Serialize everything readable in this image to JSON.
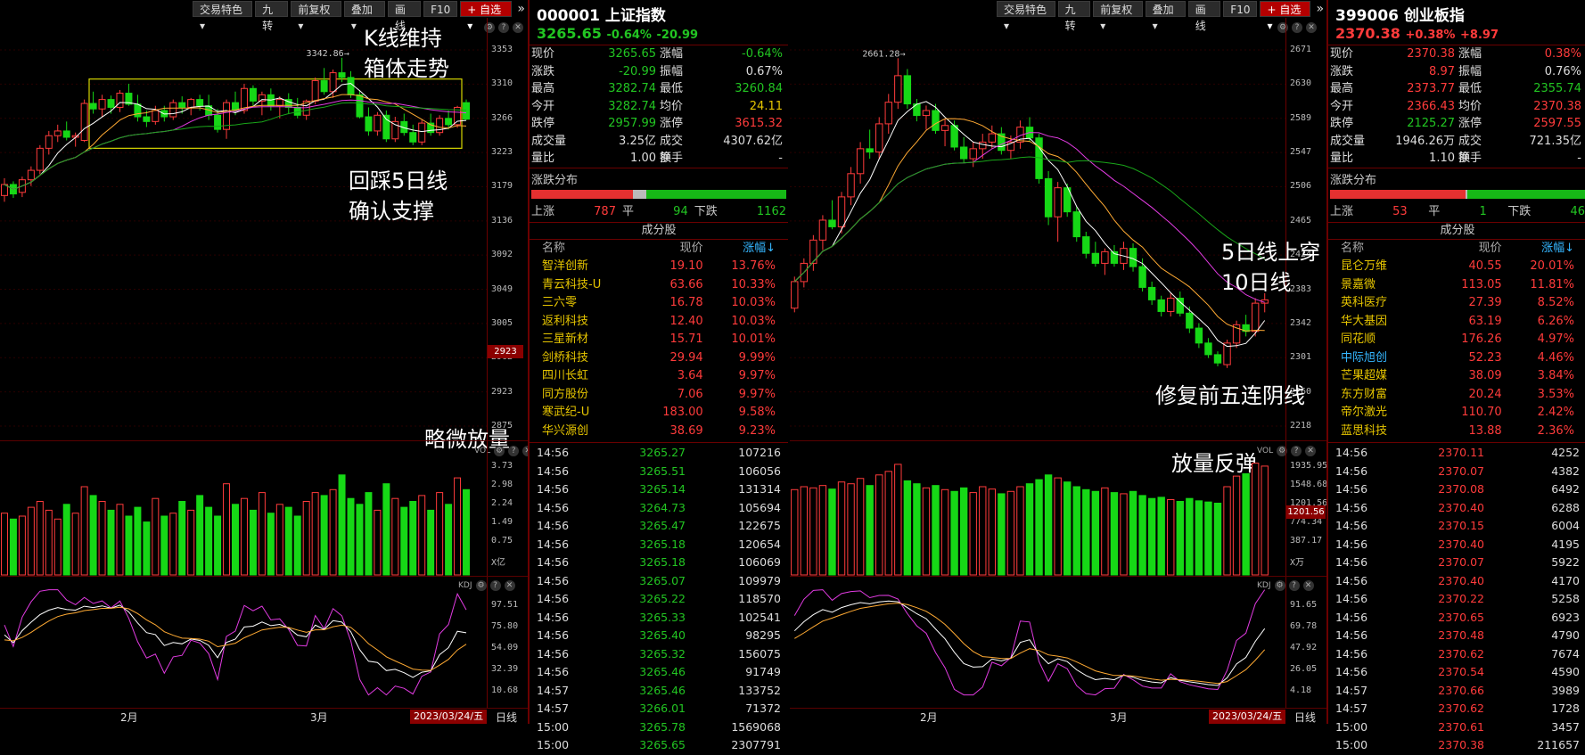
{
  "toolbar": {
    "items": [
      "交易特色",
      "九转",
      "前复权",
      "叠加",
      "画线",
      "F10",
      "自选"
    ],
    "more": "»"
  },
  "left": {
    "index_code": "000001",
    "index_name": "上证指数",
    "price": "3265.65",
    "change_pct": "-0.64%",
    "change": "-20.99",
    "price_axis": [
      "3353",
      "3310",
      "3266",
      "3223",
      "3179",
      "3136",
      "3092",
      "3049",
      "3005",
      "2962",
      "2923",
      "2875"
    ],
    "current_box": "2923",
    "high_marker": "3342.86",
    "vol_axis": [
      "3.73",
      "2.98",
      "2.24",
      "1.49",
      "0.75",
      "X亿"
    ],
    "vol_label": "VOL",
    "kdj_label": "KDJ",
    "kdj_axis": [
      "97.51",
      "75.80",
      "54.09",
      "32.39",
      "10.68"
    ],
    "months": [
      "2月",
      "3月"
    ],
    "date": "2023/03/24/五",
    "period": "日线",
    "annotations": [
      "K线维持",
      "箱体走势",
      "回踩5日线",
      "确认支撑",
      "略微放量"
    ],
    "candles": [
      [
        3168,
        3190,
        3160,
        3182
      ],
      [
        3182,
        3186,
        3165,
        3170
      ],
      [
        3172,
        3192,
        3166,
        3188
      ],
      [
        3188,
        3205,
        3180,
        3200
      ],
      [
        3200,
        3232,
        3195,
        3228
      ],
      [
        3228,
        3250,
        3220,
        3244
      ],
      [
        3244,
        3258,
        3236,
        3250
      ],
      [
        3250,
        3262,
        3238,
        3242
      ],
      [
        3242,
        3248,
        3230,
        3244
      ],
      [
        3238,
        3290,
        3236,
        3285
      ],
      [
        3285,
        3300,
        3272,
        3278
      ],
      [
        3278,
        3296,
        3268,
        3290
      ],
      [
        3290,
        3295,
        3272,
        3280
      ],
      [
        3280,
        3302,
        3274,
        3298
      ],
      [
        3298,
        3310,
        3282,
        3284
      ],
      [
        3284,
        3296,
        3262,
        3268
      ],
      [
        3268,
        3276,
        3255,
        3262
      ],
      [
        3262,
        3282,
        3258,
        3276
      ],
      [
        3276,
        3282,
        3262,
        3268
      ],
      [
        3268,
        3290,
        3264,
        3286
      ],
      [
        3286,
        3294,
        3272,
        3280
      ],
      [
        3280,
        3292,
        3270,
        3290
      ],
      [
        3290,
        3296,
        3276,
        3282
      ],
      [
        3282,
        3296,
        3264,
        3270
      ],
      [
        3270,
        3278,
        3248,
        3252
      ],
      [
        3252,
        3290,
        3240,
        3286
      ],
      [
        3286,
        3300,
        3270,
        3276
      ],
      [
        3276,
        3310,
        3272,
        3304
      ],
      [
        3304,
        3308,
        3282,
        3288
      ],
      [
        3288,
        3300,
        3270,
        3296
      ],
      [
        3296,
        3304,
        3276,
        3282
      ],
      [
        3282,
        3294,
        3266,
        3290
      ],
      [
        3290,
        3298,
        3272,
        3280
      ],
      [
        3280,
        3292,
        3266,
        3270
      ],
      [
        3270,
        3290,
        3264,
        3288
      ],
      [
        3288,
        3318,
        3284,
        3314
      ],
      [
        3314,
        3330,
        3296,
        3300
      ],
      [
        3300,
        3328,
        3292,
        3324
      ],
      [
        3324,
        3343,
        3312,
        3318
      ],
      [
        3318,
        3326,
        3292,
        3296
      ],
      [
        3296,
        3302,
        3266,
        3268
      ],
      [
        3268,
        3280,
        3244,
        3250
      ],
      [
        3250,
        3274,
        3244,
        3270
      ],
      [
        3270,
        3276,
        3236,
        3240
      ],
      [
        3240,
        3268,
        3236,
        3262
      ],
      [
        3262,
        3272,
        3244,
        3248
      ],
      [
        3248,
        3258,
        3232,
        3236
      ],
      [
        3236,
        3264,
        3232,
        3260
      ],
      [
        3260,
        3272,
        3244,
        3248
      ],
      [
        3248,
        3270,
        3244,
        3266
      ],
      [
        3266,
        3276,
        3252,
        3258
      ],
      [
        3258,
        3282,
        3254,
        3280
      ],
      [
        3286,
        3290,
        3264,
        3265
      ]
    ],
    "volumes": [
      2.1,
      1.9,
      2.0,
      2.3,
      2.5,
      2.2,
      1.9,
      2.4,
      2.1,
      3.0,
      2.7,
      2.5,
      2.2,
      2.4,
      2.0,
      2.3,
      1.8,
      2.6,
      2.0,
      2.1,
      2.5,
      2.2,
      2.7,
      2.3,
      2.0,
      3.1,
      2.4,
      2.6,
      2.2,
      2.8,
      2.1,
      2.4,
      2.3,
      2.0,
      2.5,
      2.8,
      2.7,
      2.9,
      3.4,
      2.6,
      2.4,
      2.8,
      2.2,
      3.1,
      2.6,
      2.3,
      2.5,
      2.7,
      2.2,
      2.8,
      2.4,
      3.3,
      2.9
    ],
    "quote": {
      "rows": [
        [
          "现价",
          "3265.65",
          "dn",
          "涨幅",
          "-0.64%",
          "dn"
        ],
        [
          "涨跌",
          "-20.99",
          "dn",
          "振幅",
          "0.67%",
          "wh"
        ],
        [
          "最高",
          "3282.74",
          "dn",
          "最低",
          "3260.84",
          "dn"
        ],
        [
          "今开",
          "3282.74",
          "dn",
          "均价",
          "24.11",
          "yl"
        ],
        [
          "跌停",
          "2957.99",
          "dn",
          "涨停",
          "3615.32",
          "up"
        ],
        [
          "成交量",
          "3.25亿",
          "wh",
          "成交额",
          "4307.62亿",
          "wh"
        ],
        [
          "量比",
          "1.00",
          "wh",
          "换手",
          "-",
          "wh"
        ]
      ],
      "dist_title": "涨跌分布",
      "dist": {
        "up_label": "上涨",
        "up": "787",
        "flat_label": "平",
        "flat": "94",
        "down_label": "下跌",
        "down": "1162"
      },
      "dist_bar": {
        "up": 0.4,
        "flat": 0.05
      },
      "cfg_title": "成分股",
      "cfg_header": [
        "名称",
        "现价",
        "涨幅↓"
      ],
      "cfg_rows": [
        [
          "智洋创新",
          "19.10",
          "13.76%"
        ],
        [
          "青云科技-U",
          "63.66",
          "10.33%"
        ],
        [
          "三六零",
          "16.78",
          "10.03%"
        ],
        [
          "返利科技",
          "12.40",
          "10.03%"
        ],
        [
          "三星新材",
          "15.71",
          "10.01%"
        ],
        [
          "剑桥科技",
          "29.94",
          "9.99%"
        ],
        [
          "四川长虹",
          "3.64",
          "9.97%"
        ],
        [
          "同方股份",
          "7.06",
          "9.97%"
        ],
        [
          "寒武纪-U",
          "183.00",
          "9.58%"
        ],
        [
          "华兴源创",
          "38.69",
          "9.23%"
        ]
      ],
      "ticks": [
        [
          "14:56",
          "3265.27",
          "107216"
        ],
        [
          "14:56",
          "3265.51",
          "106056"
        ],
        [
          "14:56",
          "3265.14",
          "131314"
        ],
        [
          "14:56",
          "3264.73",
          "105694"
        ],
        [
          "14:56",
          "3265.47",
          "122675"
        ],
        [
          "14:56",
          "3265.18",
          "120654"
        ],
        [
          "14:56",
          "3265.18",
          "106069"
        ],
        [
          "14:56",
          "3265.07",
          "109979"
        ],
        [
          "14:56",
          "3265.22",
          "118570"
        ],
        [
          "14:56",
          "3265.33",
          "102541"
        ],
        [
          "14:56",
          "3265.40",
          "98295"
        ],
        [
          "14:56",
          "3265.32",
          "156075"
        ],
        [
          "14:56",
          "3265.46",
          "91749"
        ],
        [
          "14:57",
          "3265.46",
          "133752"
        ],
        [
          "14:57",
          "3266.01",
          "71372"
        ],
        [
          "15:00",
          "3265.78",
          "1569068"
        ],
        [
          "15:00",
          "3265.65",
          "2307791"
        ]
      ]
    }
  },
  "right": {
    "index_code": "399006",
    "index_name": "创业板指",
    "price": "2370.38",
    "change_pct": "+0.38%",
    "change": "+8.97",
    "price_axis": [
      "2671",
      "2630",
      "2589",
      "2547",
      "2506",
      "2465",
      "2424",
      "2383",
      "2342",
      "2301",
      "2260",
      "2218"
    ],
    "high_marker": "2661.28",
    "vol_axis": [
      "1935.95",
      "1548.68",
      "1201.56",
      "774.34",
      "387.17",
      "X万"
    ],
    "vol_current": "1201.56",
    "vol_label": "VOL",
    "kdj_label": "KDJ",
    "kdj_axis": [
      "91.65",
      "69.78",
      "47.92",
      "26.05",
      "4.18"
    ],
    "months": [
      "2月",
      "3月"
    ],
    "date": "2023/03/24/五",
    "period": "日线",
    "annotations": [
      "5日线上穿",
      "10日线",
      "修复前五连阴线",
      "放量反弹"
    ],
    "candles": [
      [
        2360,
        2398,
        2355,
        2392
      ],
      [
        2392,
        2420,
        2385,
        2414
      ],
      [
        2414,
        2448,
        2405,
        2442
      ],
      [
        2442,
        2472,
        2430,
        2466
      ],
      [
        2466,
        2490,
        2455,
        2458
      ],
      [
        2458,
        2500,
        2450,
        2494
      ],
      [
        2494,
        2530,
        2484,
        2522
      ],
      [
        2522,
        2560,
        2510,
        2552
      ],
      [
        2552,
        2575,
        2540,
        2548
      ],
      [
        2548,
        2590,
        2540,
        2582
      ],
      [
        2582,
        2618,
        2570,
        2608
      ],
      [
        2608,
        2661,
        2600,
        2640
      ],
      [
        2640,
        2648,
        2600,
        2606
      ],
      [
        2606,
        2612,
        2585,
        2592
      ],
      [
        2592,
        2604,
        2575,
        2598
      ],
      [
        2598,
        2606,
        2570,
        2574
      ],
      [
        2574,
        2588,
        2555,
        2580
      ],
      [
        2580,
        2586,
        2550,
        2554
      ],
      [
        2554,
        2566,
        2535,
        2540
      ],
      [
        2540,
        2560,
        2530,
        2552
      ],
      [
        2552,
        2570,
        2540,
        2560
      ],
      [
        2560,
        2580,
        2552,
        2570
      ],
      [
        2570,
        2578,
        2545,
        2550
      ],
      [
        2550,
        2568,
        2540,
        2560
      ],
      [
        2560,
        2586,
        2552,
        2578
      ],
      [
        2578,
        2590,
        2560,
        2565
      ],
      [
        2565,
        2570,
        2510,
        2516
      ],
      [
        2516,
        2525,
        2460,
        2470
      ],
      [
        2470,
        2512,
        2440,
        2505
      ],
      [
        2505,
        2510,
        2470,
        2476
      ],
      [
        2476,
        2482,
        2440,
        2446
      ],
      [
        2446,
        2452,
        2420,
        2426
      ],
      [
        2426,
        2440,
        2410,
        2414
      ],
      [
        2414,
        2432,
        2400,
        2428
      ],
      [
        2428,
        2436,
        2410,
        2414
      ],
      [
        2414,
        2440,
        2406,
        2432
      ],
      [
        2432,
        2438,
        2404,
        2410
      ],
      [
        2410,
        2420,
        2380,
        2385
      ],
      [
        2385,
        2392,
        2364,
        2370
      ],
      [
        2370,
        2375,
        2350,
        2356
      ],
      [
        2356,
        2378,
        2350,
        2372
      ],
      [
        2372,
        2380,
        2350,
        2354
      ],
      [
        2354,
        2362,
        2330,
        2336
      ],
      [
        2336,
        2342,
        2312,
        2318
      ],
      [
        2318,
        2324,
        2300,
        2304
      ],
      [
        2304,
        2308,
        2290,
        2294
      ],
      [
        2292,
        2322,
        2288,
        2318
      ],
      [
        2318,
        2345,
        2312,
        2340
      ],
      [
        2340,
        2352,
        2326,
        2332
      ],
      [
        2332,
        2372,
        2326,
        2366
      ],
      [
        2366,
        2378,
        2355,
        2370
      ]
    ],
    "volumes": [
      1450,
      1500,
      1480,
      1520,
      1460,
      1580,
      1550,
      1640,
      1520,
      1700,
      1760,
      1880,
      1600,
      1550,
      1480,
      1520,
      1450,
      1420,
      1480,
      1400,
      1500,
      1460,
      1380,
      1420,
      1500,
      1550,
      1620,
      1700,
      1650,
      1580,
      1500,
      1450,
      1420,
      1480,
      1400,
      1380,
      1420,
      1350,
      1300,
      1320,
      1280,
      1250,
      1300,
      1260,
      1240,
      1220,
      1500,
      1680,
      1720,
      1900,
      1850
    ],
    "quote": {
      "rows": [
        [
          "现价",
          "2370.38",
          "up",
          "涨幅",
          "0.38%",
          "up"
        ],
        [
          "涨跌",
          "8.97",
          "up",
          "振幅",
          "0.76%",
          "wh"
        ],
        [
          "最高",
          "2373.77",
          "up",
          "最低",
          "2355.74",
          "dn"
        ],
        [
          "今开",
          "2366.43",
          "up",
          "均价",
          "2370.38",
          "up"
        ],
        [
          "跌停",
          "2125.27",
          "dn",
          "涨停",
          "2597.55",
          "up"
        ],
        [
          "成交量",
          "1946.26万",
          "wh",
          "成交额",
          "721.35亿",
          "wh"
        ],
        [
          "量比",
          "1.10",
          "wh",
          "换手",
          "-",
          "wh"
        ]
      ],
      "dist_title": "涨跌分布",
      "dist": {
        "up_label": "上涨",
        "up": "53",
        "flat_label": "平",
        "flat": "1",
        "down_label": "下跌",
        "down": "46"
      },
      "dist_bar": {
        "up": 0.53,
        "flat": 0.01
      },
      "cfg_title": "成分股",
      "cfg_header": [
        "名称",
        "现价",
        "涨幅↓"
      ],
      "cfg_rows": [
        [
          "昆仑万维",
          "40.55",
          "20.01%",
          "yl"
        ],
        [
          "景嘉微",
          "113.05",
          "11.81%",
          "yl"
        ],
        [
          "英科医疗",
          "27.39",
          "8.52%",
          "yl"
        ],
        [
          "华大基因",
          "63.19",
          "6.26%",
          "yl"
        ],
        [
          "同花顺",
          "176.26",
          "4.97%",
          "yl"
        ],
        [
          "中际旭创",
          "52.23",
          "4.46%",
          "cy"
        ],
        [
          "芒果超媒",
          "38.09",
          "3.84%",
          "yl"
        ],
        [
          "东方财富",
          "20.24",
          "3.53%",
          "yl"
        ],
        [
          "帝尔激光",
          "110.70",
          "2.42%",
          "yl"
        ],
        [
          "蓝思科技",
          "13.88",
          "2.36%",
          "yl"
        ]
      ],
      "ticks": [
        [
          "14:56",
          "2370.11",
          "4252"
        ],
        [
          "14:56",
          "2370.07",
          "4382"
        ],
        [
          "14:56",
          "2370.08",
          "6492"
        ],
        [
          "14:56",
          "2370.40",
          "6288"
        ],
        [
          "14:56",
          "2370.15",
          "6004"
        ],
        [
          "14:56",
          "2370.40",
          "4195"
        ],
        [
          "14:56",
          "2370.07",
          "5922"
        ],
        [
          "14:56",
          "2370.40",
          "4170"
        ],
        [
          "14:56",
          "2370.22",
          "5258"
        ],
        [
          "14:56",
          "2370.65",
          "6923"
        ],
        [
          "14:56",
          "2370.48",
          "4790"
        ],
        [
          "14:56",
          "2370.62",
          "7674"
        ],
        [
          "14:56",
          "2370.54",
          "4590"
        ],
        [
          "14:57",
          "2370.66",
          "3989"
        ],
        [
          "14:57",
          "2370.62",
          "1728"
        ],
        [
          "15:00",
          "2370.61",
          "3457"
        ],
        [
          "15:00",
          "2370.38",
          "211657"
        ]
      ]
    }
  }
}
